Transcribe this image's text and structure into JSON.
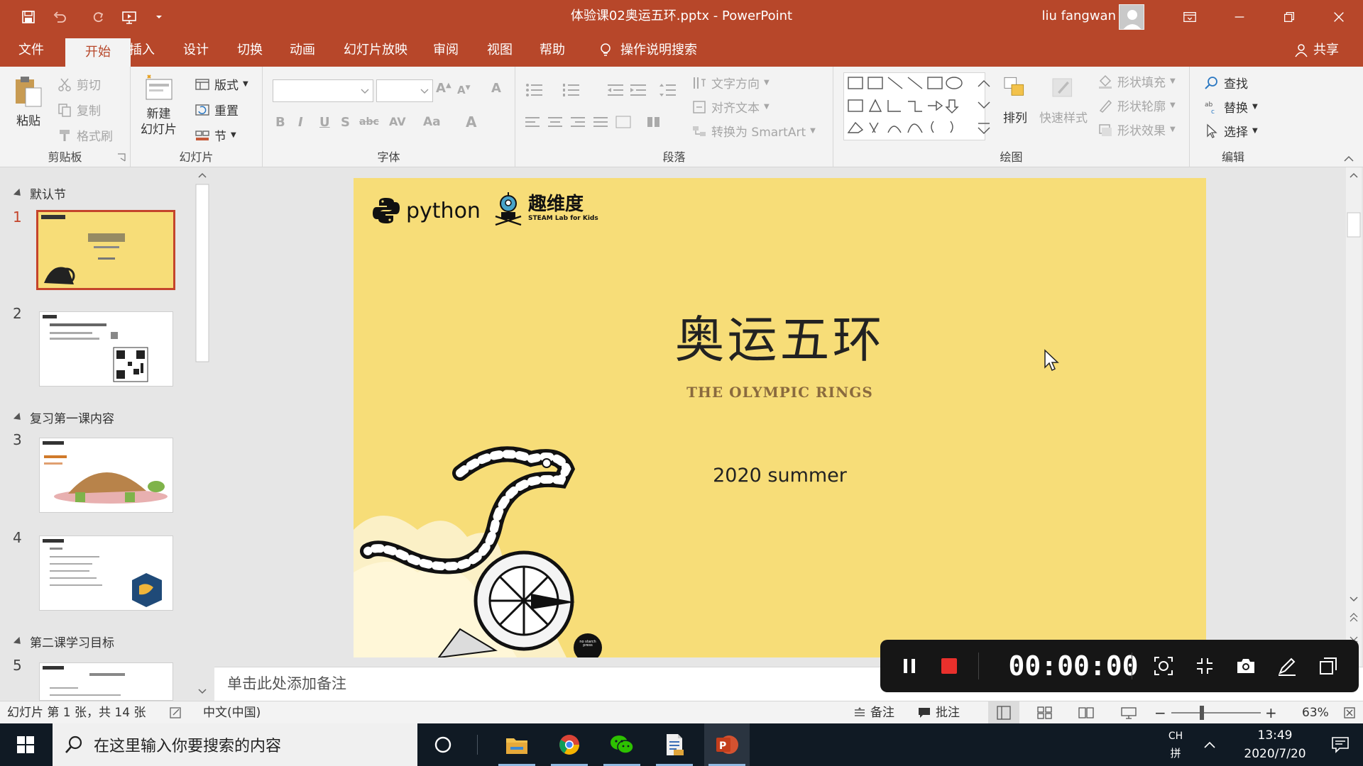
{
  "window": {
    "title": "体验课02奥运五环.pptx  -  PowerPoint",
    "user_name": "liu fangwan"
  },
  "menu": {
    "tabs": [
      "文件",
      "开始",
      "插入",
      "设计",
      "切换",
      "动画",
      "幻灯片放映",
      "审阅",
      "视图",
      "帮助"
    ],
    "active_index": 1,
    "tell_me": "操作说明搜索",
    "share": "共享"
  },
  "ribbon": {
    "clipboard": {
      "label": "剪贴板",
      "paste": "粘贴",
      "cut": "剪切",
      "copy": "复制",
      "format_painter": "格式刷"
    },
    "slides": {
      "label": "幻灯片",
      "new_slide_1": "新建",
      "new_slide_2": "幻灯片",
      "layout": "版式",
      "reset": "重置",
      "section": "节"
    },
    "font": {
      "label": "字体",
      "font_name": "",
      "font_size": ""
    },
    "paragraph": {
      "label": "段落",
      "text_direction": "文字方向",
      "align_text": "对齐文本",
      "smartart": "转换为 SmartArt"
    },
    "drawing": {
      "label": "绘图",
      "arrange": "排列",
      "quick_styles": "快速样式",
      "shape_fill": "形状填充",
      "shape_outline": "形状轮廓",
      "shape_effects": "形状效果"
    },
    "editing": {
      "label": "编辑",
      "find": "查找",
      "replace": "替换",
      "select": "选择"
    }
  },
  "thumbnails": {
    "sections": [
      "默认节",
      "复习第一课内容",
      "第二课学习目标"
    ],
    "numbers": [
      "1",
      "2",
      "3",
      "4",
      "5"
    ],
    "selected": 1
  },
  "slide": {
    "logo_python": "python",
    "logo_brand": "趣维度",
    "logo_brand_sub": "STEAM Lab for Kids",
    "title": "奥运五环",
    "subtitle": "THE OLYMPIC RINGS",
    "date_text": "2020 summer",
    "publisher_badge": "no starch press",
    "bg_color": "#f7dd78"
  },
  "notes": {
    "placeholder": "单击此处添加备注"
  },
  "status": {
    "slide_info": "幻灯片 第 1 张，共 14 张",
    "language": "中文(中国)",
    "notes_btn": "备注",
    "comments_btn": "批注",
    "zoom": "63%"
  },
  "recorder": {
    "timer": "00:00:00"
  },
  "taskbar": {
    "search_placeholder": "在这里输入你要搜索的内容",
    "ime_lang": "CH",
    "ime_mode": "拼",
    "time": "13:49",
    "date": "2020/7/20"
  }
}
